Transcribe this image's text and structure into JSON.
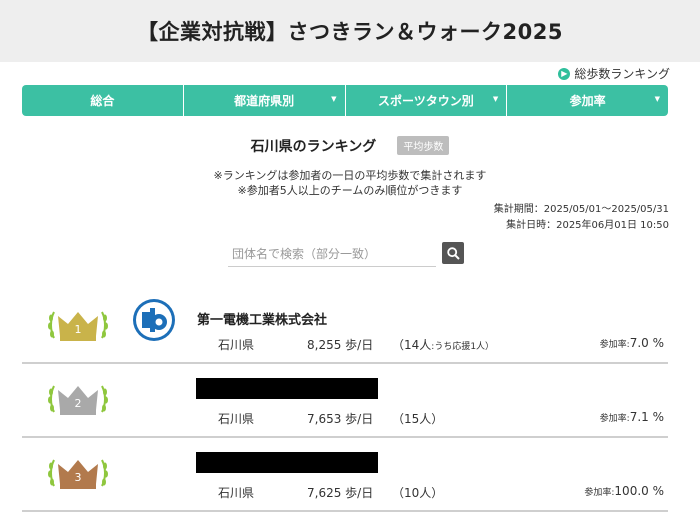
{
  "title": "【企業対抗戦】さつきラン＆ウォーク2025",
  "total_link": "総歩数ランキング",
  "nav": [
    {
      "label": "総合"
    },
    {
      "label": "都道府県別"
    },
    {
      "label": "スポーツタウン別"
    },
    {
      "label": "参加率"
    }
  ],
  "heading": "石川県のランキング",
  "badge": "平均歩数",
  "note1": "※ランキングは参加者の一日の平均歩数で集計されます",
  "note2": "※参加者5人以上のチームのみ順位がつきます",
  "period": "集計期間：2025/05/01～2025/05/31",
  "updated": "集計日時：2025年06月01日 10:50",
  "search_placeholder": "団体名で検索（部分一致）",
  "colors": {
    "accent": "#3cc0a3",
    "gold": "#c9b34a",
    "silver": "#a9a9a9",
    "bronze": "#b27a4d"
  },
  "rankings": [
    {
      "rank": "1",
      "name": "第一電機工業株式会社",
      "pref": "石川県",
      "steps": "8,255 歩/日",
      "members": "（14人",
      "members_note": ":うち応援1人）",
      "rate_label": "参加率:",
      "rate": "7.0 %"
    },
    {
      "rank": "2",
      "name": "",
      "pref": "石川県",
      "steps": "7,653 歩/日",
      "members": "（15人）",
      "members_note": "",
      "rate_label": "参加率:",
      "rate": "7.1 %"
    },
    {
      "rank": "3",
      "name": "",
      "pref": "石川県",
      "steps": "7,625 歩/日",
      "members": "（10人）",
      "members_note": "",
      "rate_label": "参加率:",
      "rate": "100.0 %"
    }
  ]
}
